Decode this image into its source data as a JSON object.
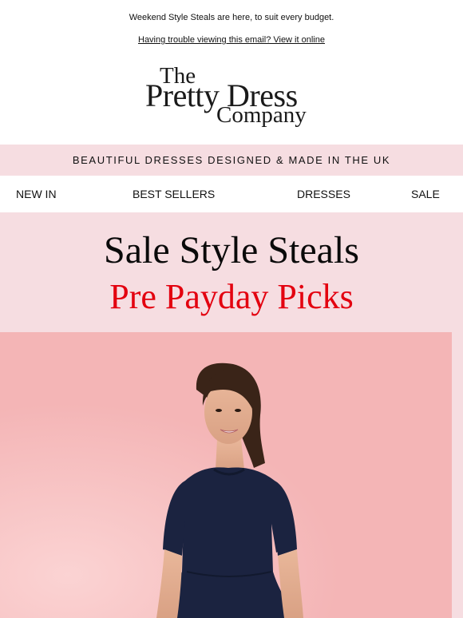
{
  "preheader": {
    "text": "Weekend Style Steals are here, to suit every budget.",
    "view_online": "Having trouble viewing this email? View it online"
  },
  "logo": {
    "line1": "The",
    "line2": "Pretty Dress",
    "line3": "Company"
  },
  "tagline": "BEAUTIFUL DRESSES DESIGNED & MADE IN THE UK",
  "nav": {
    "items": [
      {
        "label": "NEW IN"
      },
      {
        "label": "BEST SELLERS"
      },
      {
        "label": "DRESSES"
      },
      {
        "label": "SALE"
      }
    ]
  },
  "hero": {
    "title": "Sale Style Steals",
    "subtitle": "Pre Payday Picks"
  },
  "colors": {
    "pink_band": "#f6dde1",
    "accent_red": "#e3000f",
    "hero_bg": "#f4b5b6",
    "dress_navy": "#1b2340"
  }
}
